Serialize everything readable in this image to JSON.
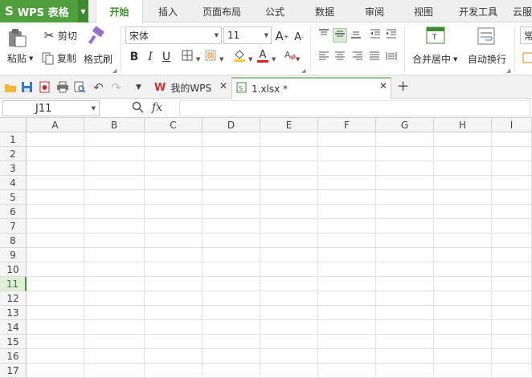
{
  "app": {
    "brand": "WPS 表格"
  },
  "menu": {
    "tabs": [
      {
        "label": "开始",
        "active": true
      },
      {
        "label": "插入"
      },
      {
        "label": "页面布局"
      },
      {
        "label": "公式"
      },
      {
        "label": "数据"
      },
      {
        "label": "审阅"
      },
      {
        "label": "视图"
      },
      {
        "label": "开发工具"
      },
      {
        "label": "云服"
      }
    ]
  },
  "ribbon": {
    "paste_label": "粘贴",
    "cut_label": "剪切",
    "copy_label": "复制",
    "format_painter_label": "格式刷",
    "font_name": "宋体",
    "font_size": "11",
    "bold": "B",
    "italic": "I",
    "underline": "U",
    "merge_center_label": "合并居中",
    "wrap_text_label": "自动换行",
    "style_partial": "常"
  },
  "doc_tabs": [
    {
      "label": "我的WPS",
      "active": false
    },
    {
      "label": "1.xlsx *",
      "active": true
    }
  ],
  "formula_bar": {
    "name_box": "J11",
    "fx": "fx",
    "value": ""
  },
  "sheet": {
    "columns": [
      "A",
      "B",
      "C",
      "D",
      "E",
      "F",
      "G",
      "H",
      "I"
    ],
    "rows": [
      "1",
      "2",
      "3",
      "4",
      "5",
      "6",
      "7",
      "8",
      "9",
      "10",
      "11",
      "12",
      "13",
      "14",
      "15",
      "16",
      "17"
    ],
    "active_row": "11"
  },
  "colors": {
    "brand_green": "#4f9f3d",
    "active_tab_text": "#3b8c2a",
    "selection_green": "#3b9c2a"
  }
}
